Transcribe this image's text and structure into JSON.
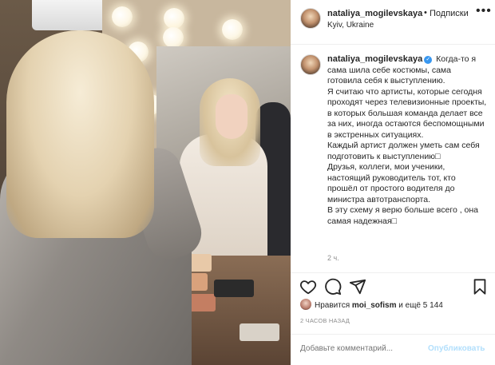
{
  "post": {
    "header": {
      "username": "nataliya_mogilevskaya",
      "separator": "•",
      "follow_label": "Подписки",
      "more_icon": "more-horizontal-icon",
      "location": "Kyiv, Ukraine"
    },
    "caption": {
      "username": "nataliya_mogilevskaya",
      "verified_icon": "verified-badge-icon",
      "text": "Когда-то я сама шила себе костюмы, сама готовила себя к выступлению.\nЯ считаю что артисты, которые сегодня проходят через телевизионные проекты, в которых большая команда делает все за них, иногда остаются беспомощными в экстренных ситуациях.\nКаждый артист должен уметь сам себя подготовить к выступлению□\nДрузья, коллеги, мои ученики, настоящий руководитель тот, кто прошёл от простого водителя до министра автотранспорта.\nВ эту схему я верю больше всего , она самая надежная□",
      "time_ago": "2 ч."
    },
    "actions": {
      "like_icon": "heart-icon",
      "comment_icon": "comment-icon",
      "share_icon": "send-icon",
      "save_icon": "bookmark-icon"
    },
    "likes": {
      "prefix": "Нравится ",
      "user": "moi_sofism",
      "suffix": " и ещё 5 144"
    },
    "posted": "2 ЧАСОВ НАЗАД",
    "comment": {
      "placeholder": "Добавьте комментарий...",
      "post_label": "Опубликовать"
    }
  }
}
